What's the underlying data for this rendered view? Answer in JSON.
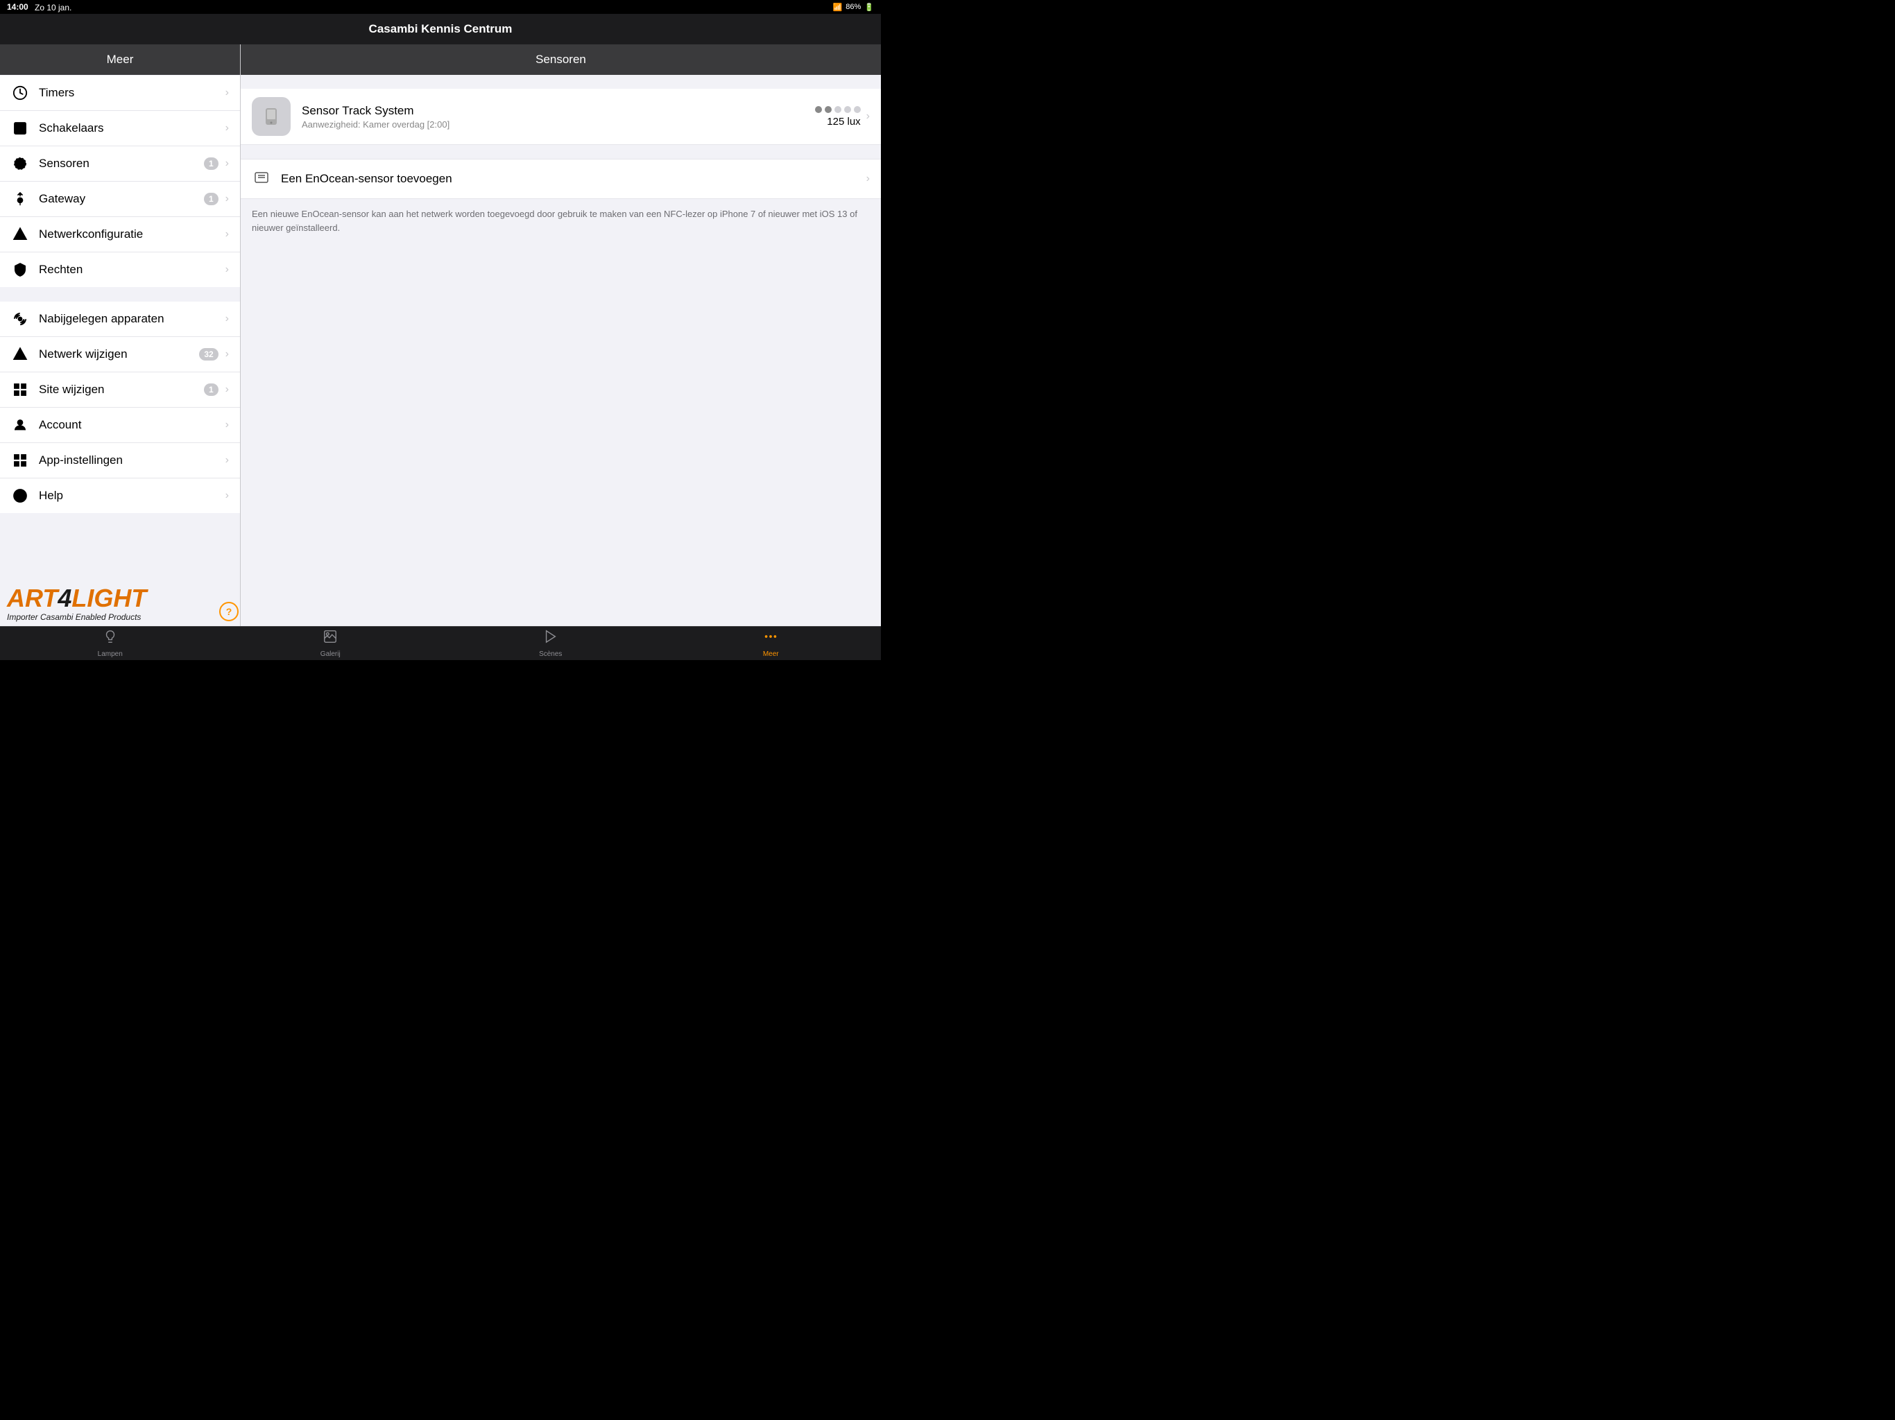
{
  "statusBar": {
    "time": "14:00",
    "day": "Zo 10 jan.",
    "wifi": "wifi",
    "battery": "86%"
  },
  "titleBar": {
    "title": "Casambi Kennis Centrum"
  },
  "sidebar": {
    "header": "Meer",
    "groups": [
      {
        "items": [
          {
            "id": "timers",
            "label": "Timers",
            "icon": "clock",
            "badge": null
          },
          {
            "id": "schakelaars",
            "label": "Schakelaars",
            "icon": "switch",
            "badge": null
          },
          {
            "id": "sensoren",
            "label": "Sensoren",
            "icon": "sensor",
            "badge": "1"
          },
          {
            "id": "gateway",
            "label": "Gateway",
            "icon": "gateway",
            "badge": "1"
          },
          {
            "id": "netwerkconfiguratie",
            "label": "Netwerkconfiguratie",
            "icon": "network-config",
            "badge": null
          },
          {
            "id": "rechten",
            "label": "Rechten",
            "icon": "rights",
            "badge": null
          }
        ]
      },
      {
        "items": [
          {
            "id": "nabijgelegen",
            "label": "Nabijgelegen apparaten",
            "icon": "nearby",
            "badge": null
          },
          {
            "id": "netwerk-wijzigen",
            "label": "Netwerk wijzigen",
            "icon": "network-change",
            "badge": "32"
          },
          {
            "id": "site-wijzigen",
            "label": "Site wijzigen",
            "icon": "site-change",
            "badge": "1"
          },
          {
            "id": "account",
            "label": "Account",
            "icon": "account",
            "badge": null
          },
          {
            "id": "app-instellingen",
            "label": "App-instellingen",
            "icon": "app-settings",
            "badge": null
          },
          {
            "id": "help",
            "label": "Help",
            "icon": "help-info",
            "badge": null
          }
        ]
      }
    ]
  },
  "rightPanel": {
    "header": "Sensoren",
    "sensor": {
      "name": "Sensor Track System",
      "sub": "Aanwezigheid: Kamer overdag [2:00]",
      "dots": [
        true,
        true,
        false,
        false,
        false
      ],
      "lux": "125 lux"
    },
    "addSensor": {
      "label": "Een EnOcean-sensor toevoegen",
      "description": "Een nieuwe EnOcean-sensor kan aan het netwerk worden toegevoegd door gebruik te maken van een NFC-lezer op iPhone 7 of nieuwer met iOS 13 of nieuwer geïnstalleerd."
    }
  },
  "tabBar": {
    "tabs": [
      {
        "id": "lampen",
        "label": "Lampen",
        "icon": "lamp",
        "active": false
      },
      {
        "id": "galerij",
        "label": "Galerij",
        "icon": "gallery",
        "active": false
      },
      {
        "id": "scenes",
        "label": "Scènes",
        "icon": "scenes",
        "active": false
      },
      {
        "id": "meer",
        "label": "Meer",
        "icon": "more",
        "active": true
      }
    ]
  },
  "watermark": {
    "logoText": "ART",
    "fourText": "4",
    "lightText": "LIGHT",
    "tagline": "Importer Casambi Enabled Products"
  },
  "helpButton": "?"
}
